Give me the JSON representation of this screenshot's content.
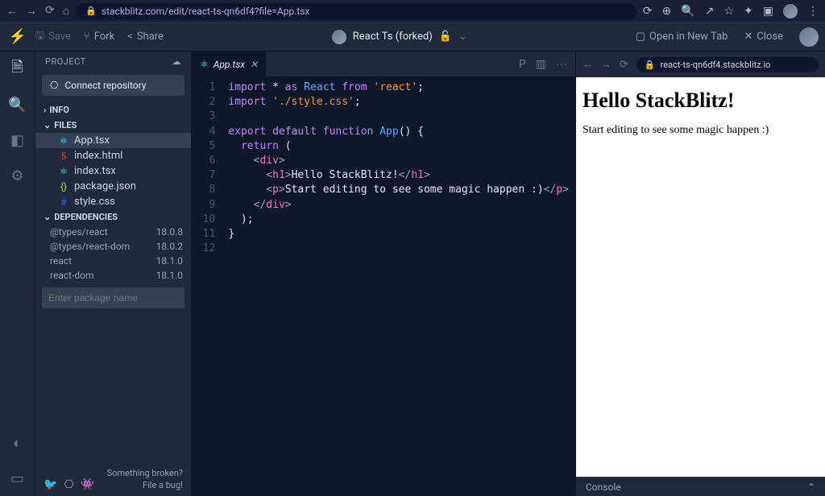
{
  "browser": {
    "url": "stackblitz.com/edit/react-ts-qn6df4?file=App.tsx"
  },
  "toolbar": {
    "save": "Save",
    "fork": "Fork",
    "share": "Share",
    "projectTitle": "React Ts (forked)",
    "openNewTab": "Open in New Tab",
    "close": "Close"
  },
  "sidebar": {
    "title": "PROJECT",
    "connect": "Connect repository",
    "sections": {
      "info": "INFO",
      "files": "FILES",
      "deps": "DEPENDENCIES"
    },
    "files": [
      {
        "name": "App.tsx",
        "icon": "⚛",
        "active": true,
        "color": "#61dafb"
      },
      {
        "name": "index.html",
        "icon": "5",
        "active": false,
        "color": "#e34c26"
      },
      {
        "name": "index.tsx",
        "icon": "⚛",
        "active": false,
        "color": "#61dafb"
      },
      {
        "name": "package.json",
        "icon": "{}",
        "active": false,
        "color": "#cbcb41"
      },
      {
        "name": "style.css",
        "icon": "#",
        "active": false,
        "color": "#2965f1"
      }
    ],
    "dependencies": [
      {
        "name": "@types/react",
        "version": "18.0.8"
      },
      {
        "name": "@types/react-dom",
        "version": "18.0.2"
      },
      {
        "name": "react",
        "version": "18.1.0"
      },
      {
        "name": "react-dom",
        "version": "18.1.0"
      }
    ],
    "depPlaceholder": "Enter package name",
    "footer": {
      "broken": "Something broken?",
      "file": "File a bug!"
    }
  },
  "editor": {
    "tabName": "App.tsx",
    "lineNumbers": [
      "1",
      "2",
      "3",
      "4",
      "5",
      "6",
      "7",
      "8",
      "9",
      "10",
      "11",
      "12"
    ]
  },
  "code": {
    "import1_import": "import",
    "import1_star": " * ",
    "import1_as": "as",
    "import1_react": " React ",
    "import1_from": "from",
    "import1_str": " 'react'",
    "semi": ";",
    "import2_import": "import",
    "import2_str": " './style.css'",
    "export": "export",
    "default": " default ",
    "function": "function",
    "appname": " App",
    "parens": "() {",
    "return": "  return",
    "return_paren": " (",
    "div_open_lt": "    <",
    "div_open_tag": "div",
    "div_open_gt": ">",
    "h1_open_lt": "      <",
    "h1_tag": "h1",
    "h1_gt": ">",
    "h1_text": "Hello StackBlitz!",
    "h1_close_lt": "</",
    "p_open_lt": "      <",
    "p_tag": "p",
    "p_gt": ">",
    "p_text": "Start editing to see some magic happen :)",
    "p_close_lt": "</",
    "div_close_lt": "    </",
    "close_paren": "  );",
    "close_brace": "}"
  },
  "preview": {
    "url": "react-ts-qn6df4.stackblitz.io",
    "h1": "Hello StackBlitz!",
    "p": "Start editing to see some magic happen :)",
    "console": "Console"
  }
}
